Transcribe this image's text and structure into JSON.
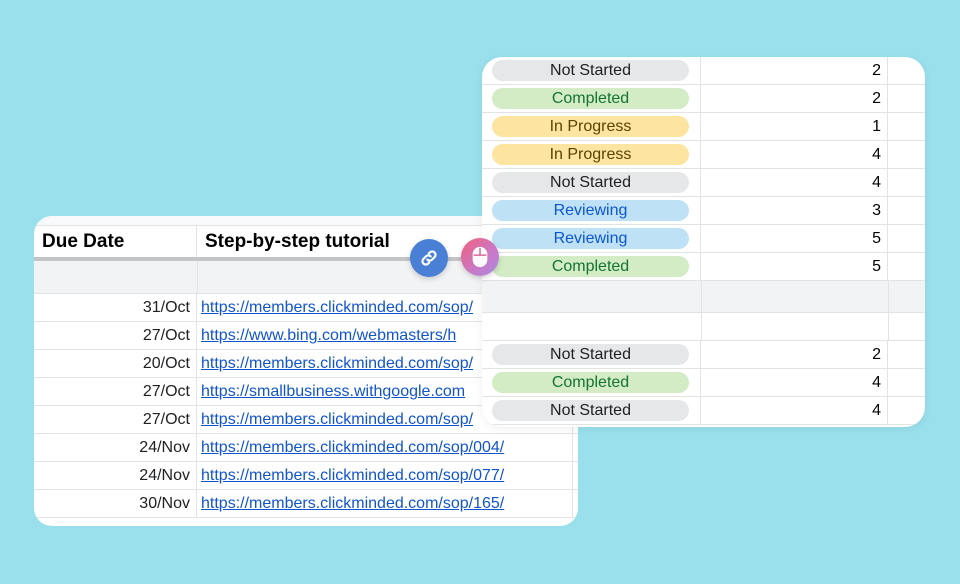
{
  "due_sheet": {
    "headers": {
      "due_date": "Due Date",
      "tutorial": "Step-by-step tutorial"
    },
    "rows": [
      {
        "date": "31/Oct",
        "url": "https://members.clickminded.com/sop/"
      },
      {
        "date": "27/Oct",
        "url": "https://www.bing.com/webmasters/h"
      },
      {
        "date": "20/Oct",
        "url": "https://members.clickminded.com/sop/"
      },
      {
        "date": "27/Oct",
        "url": "https://smallbusiness.withgoogle.com"
      },
      {
        "date": "27/Oct",
        "url": "https://members.clickminded.com/sop/"
      },
      {
        "date": "24/Nov",
        "url": "https://members.clickminded.com/sop/004/"
      },
      {
        "date": "24/Nov",
        "url": "https://members.clickminded.com/sop/077/"
      },
      {
        "date": "30/Nov",
        "url": "https://members.clickminded.com/sop/165/"
      }
    ]
  },
  "floating_buttons": {
    "link_icon": "link-icon",
    "mouse_icon": "mouse-icon",
    "link_color": "#4a7fd6"
  },
  "status_sheet": {
    "group_a": [
      {
        "status": "Not Started",
        "kind": "ns",
        "count": "2"
      },
      {
        "status": "Completed",
        "kind": "cp",
        "count": "2"
      },
      {
        "status": "In Progress",
        "kind": "ip",
        "count": "1"
      },
      {
        "status": "In Progress",
        "kind": "ip",
        "count": "4"
      },
      {
        "status": "Not Started",
        "kind": "ns",
        "count": "4"
      },
      {
        "status": "Reviewing",
        "kind": "rv",
        "count": "3"
      },
      {
        "status": "Reviewing",
        "kind": "rv",
        "count": "5"
      },
      {
        "status": "Completed",
        "kind": "cp",
        "count": "5"
      }
    ],
    "group_b": [
      {
        "status": "Not Started",
        "kind": "ns",
        "count": "2"
      },
      {
        "status": "Completed",
        "kind": "cp",
        "count": "4"
      },
      {
        "status": "Not Started",
        "kind": "ns",
        "count": "4"
      }
    ],
    "colors": {
      "not_started": "#e6e7e9",
      "completed": "#d3ecc6",
      "in_progress": "#fde4a0",
      "reviewing": "#bfe1f6",
      "background": "#99e0ec"
    }
  }
}
